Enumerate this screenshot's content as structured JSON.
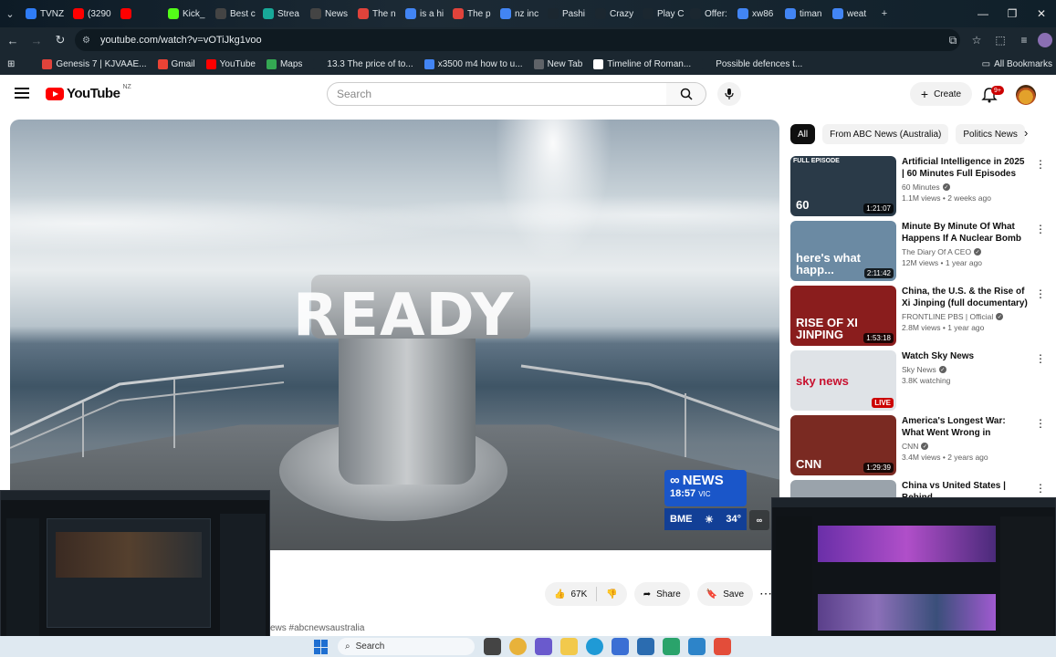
{
  "browser": {
    "tabs": [
      {
        "label": "TVNZ",
        "color": "#2f7cf6"
      },
      {
        "label": "(3290",
        "color": "#ff0000"
      },
      {
        "label": "",
        "color": "#ff0000"
      },
      {
        "label": "Kick_",
        "color": "#53fc18"
      },
      {
        "label": "Best c",
        "color": "#444444"
      },
      {
        "label": "Strea",
        "color": "#18a999"
      },
      {
        "label": "News",
        "color": "#444444"
      },
      {
        "label": "The n",
        "color": "#e0433b"
      },
      {
        "label": "is a hi",
        "color": "#4285f4"
      },
      {
        "label": "The p",
        "color": "#e0433b"
      },
      {
        "label": "nz inc",
        "color": "#4285f4"
      },
      {
        "label": "Pashi",
        "color": "#1b2730"
      },
      {
        "label": "Crazy",
        "color": "#1b2730"
      },
      {
        "label": "Play C",
        "color": "#1b2730"
      },
      {
        "label": "Offer:",
        "color": "#1b2730"
      },
      {
        "label": "xw86",
        "color": "#4285f4"
      },
      {
        "label": "timan",
        "color": "#4285f4"
      },
      {
        "label": "weat",
        "color": "#4285f4"
      }
    ],
    "url": "youtube.com/watch?v=vOTiJkg1voo",
    "bookmarks": [
      {
        "label": "Genesis 7 | KJVAAE...",
        "color": "#e0433b"
      },
      {
        "label": "Gmail",
        "color": "#ea4335"
      },
      {
        "label": "YouTube",
        "color": "#ff0000"
      },
      {
        "label": "Maps",
        "color": "#34a853"
      },
      {
        "label": "13.3 The price of to...",
        "color": "#1b2730"
      },
      {
        "label": "x3500 m4 how to u...",
        "color": "#4285f4"
      },
      {
        "label": "New Tab",
        "color": "#5f6368"
      },
      {
        "label": "Timeline of Roman...",
        "color": "#ffffff"
      },
      {
        "label": "Possible defences t...",
        "color": "#1b2730"
      }
    ],
    "all_bookmarks": "All Bookmarks"
  },
  "youtube": {
    "logo_word": "YouTube",
    "region": "NZ",
    "search_placeholder": "Search",
    "create_label": "Create",
    "notification_count": "9+"
  },
  "video": {
    "overlay_word": "READY",
    "abc_brand": "NEWS",
    "abc_time": "18:57",
    "abc_zone": "VIC",
    "weather_place": "BME",
    "weather_temp": "34°",
    "likes": "67K",
    "share_label": "Share",
    "save_label": "Save",
    "hashtags": "ews #abcnewsaustralia"
  },
  "chips": [
    {
      "label": "All",
      "active": true
    },
    {
      "label": "From ABC News (Australia)",
      "active": false
    },
    {
      "label": "Politics News",
      "active": false
    }
  ],
  "recommendations": [
    {
      "title": "Artificial Intelligence in 2025 | 60 Minutes Full Episodes",
      "channel": "60 Minutes",
      "meta": "1.1M views • 2 weeks ago",
      "duration": "1:21:07",
      "thumb_label": "FULL EPISODE",
      "thumb_text": "60",
      "thumb_color": "#2a3a48"
    },
    {
      "title": "Minute By Minute Of What Happens If A Nuclear Bomb ...",
      "channel": "The Diary Of A CEO",
      "meta": "12M views • 1 year ago",
      "duration": "2:11:42",
      "thumb_label": "",
      "thumb_text": "here's what happ...",
      "thumb_color": "#6b8aa3"
    },
    {
      "title": "China, the U.S. & the Rise of Xi Jinping (full documentary) | ...",
      "channel": "FRONTLINE PBS | Official",
      "meta": "2.8M views • 1 year ago",
      "duration": "1:53:18",
      "thumb_label": "",
      "thumb_text": "RISE OF XI JINPING",
      "thumb_color": "#8a1d1d"
    },
    {
      "title": "Watch Sky News",
      "channel": "Sky News",
      "meta": "3.8K watching",
      "duration": "LIVE",
      "thumb_label": "",
      "thumb_text": "sky news",
      "thumb_color": "#dfe3e7"
    },
    {
      "title": "America's Longest War: What Went Wrong in Afghanistan ...",
      "channel": "CNN",
      "meta": "3.4M views • 2 years ago",
      "duration": "1:29:39",
      "thumb_label": "",
      "thumb_text": "CNN",
      "thumb_color": "#7a2a22"
    },
    {
      "title": "China vs United States | Behind",
      "channel": "",
      "meta": "",
      "duration": "",
      "thumb_label": "",
      "thumb_text": "",
      "thumb_color": "#9aa3ab"
    }
  ],
  "taskbar": {
    "search_label": "Search"
  },
  "colors": {
    "yt_red": "#ff0000",
    "abc_blue": "#1a56c9"
  }
}
